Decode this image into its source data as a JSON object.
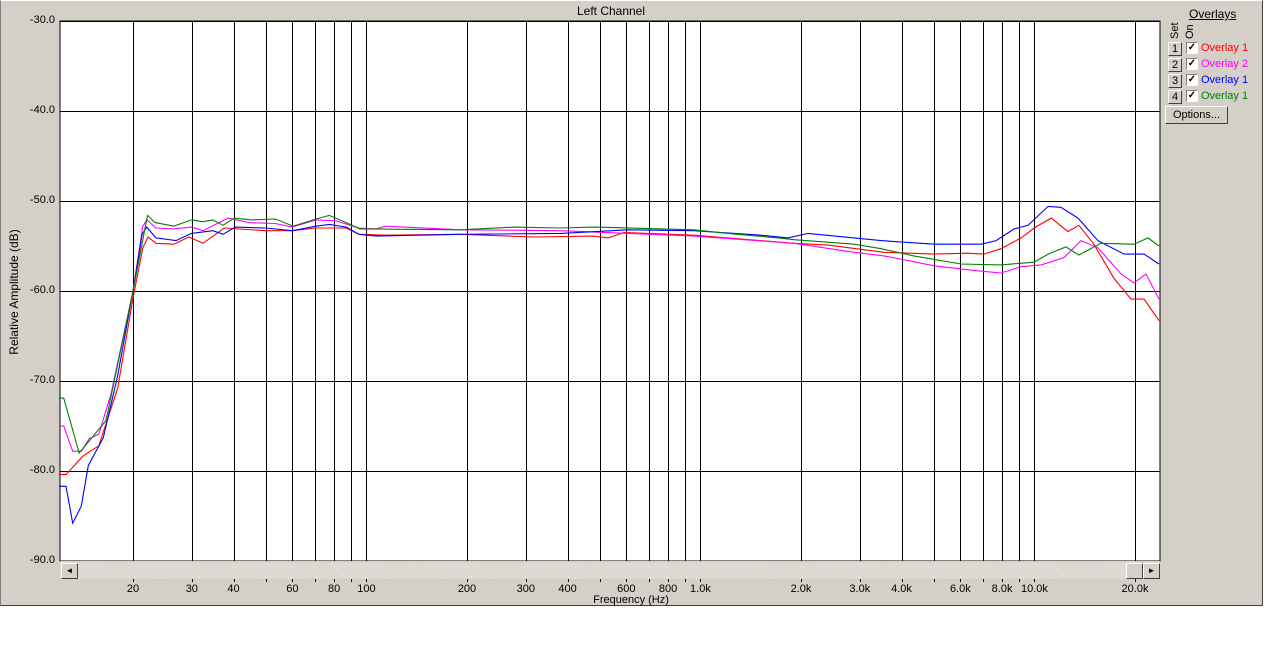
{
  "window": {
    "title": "Left Channel"
  },
  "overlays": {
    "title": "Overlays",
    "col_set": "Set",
    "col_on": "On",
    "items": [
      {
        "set": "1",
        "on": true,
        "label": "Overlay 1",
        "color": "#ff0000"
      },
      {
        "set": "2",
        "on": true,
        "label": "Overlay 2",
        "color": "#ff00ff"
      },
      {
        "set": "3",
        "on": true,
        "label": "Overlay 1",
        "color": "#0000ff"
      },
      {
        "set": "4",
        "on": true,
        "label": "Overlay 1",
        "color": "#008000"
      }
    ],
    "options_label": "Options..."
  },
  "scrollbar": {
    "left_arrow": "◄",
    "right_arrow": "►"
  },
  "chart_data": {
    "type": "line",
    "title": "Left Channel",
    "xlabel": "Frequency (Hz)",
    "ylabel": "Relative Amplitude (dB)",
    "xscale": "log",
    "xlim": [
      12,
      23600
    ],
    "ylim": [
      -90,
      -30
    ],
    "grid": true,
    "y_ticks": [
      -30,
      -40,
      -50,
      -60,
      -70,
      -80,
      -90
    ],
    "y_tick_labels": [
      "-30.0",
      "-40.0",
      "-50.0",
      "-60.0",
      "-70.0",
      "-80.0",
      "-90.0"
    ],
    "x_gridlines": [
      20,
      30,
      40,
      50,
      60,
      70,
      80,
      90,
      100,
      200,
      300,
      400,
      500,
      600,
      700,
      800,
      900,
      1000,
      2000,
      3000,
      4000,
      5000,
      6000,
      7000,
      8000,
      9000,
      10000,
      20000
    ],
    "x_ticks": [
      20,
      30,
      40,
      60,
      80,
      100,
      200,
      300,
      400,
      600,
      800,
      1000,
      2000,
      3000,
      4000,
      6000,
      8000,
      10000,
      20000
    ],
    "x_tick_labels": [
      "20",
      "30",
      "40",
      "60",
      "80",
      "100",
      "200",
      "300",
      "400",
      "600",
      "800",
      "1.0k",
      "2.0k",
      "3.0k",
      "4.0k",
      "6.0k",
      "8.0k",
      "10.0k",
      "20.0k"
    ],
    "series": [
      {
        "name": "Overlay 1 (set 1)",
        "color": "#ff0000",
        "points": [
          [
            12.0,
            -80.4
          ],
          [
            12.6,
            -80.4
          ],
          [
            14.2,
            -78.3
          ],
          [
            15.8,
            -77.2
          ],
          [
            18.0,
            -70.8
          ],
          [
            20,
            -60.8
          ],
          [
            21.4,
            -55.2
          ],
          [
            22.2,
            -54.0
          ],
          [
            23.4,
            -54.7
          ],
          [
            26.5,
            -54.8
          ],
          [
            29.4,
            -54.0
          ],
          [
            32.4,
            -54.7
          ],
          [
            37.5,
            -53.0
          ],
          [
            50,
            -53.3
          ],
          [
            60,
            -53.3
          ],
          [
            70.6,
            -53.0
          ],
          [
            87,
            -53.0
          ],
          [
            95,
            -53.7
          ],
          [
            114,
            -53.8
          ],
          [
            192,
            -53.7
          ],
          [
            317,
            -54.0
          ],
          [
            480,
            -53.9
          ],
          [
            529,
            -54.1
          ],
          [
            590,
            -53.5
          ],
          [
            956,
            -53.8
          ],
          [
            1906,
            -54.7
          ],
          [
            2410,
            -54.9
          ],
          [
            3546,
            -55.7
          ],
          [
            5002,
            -55.9
          ],
          [
            6325,
            -55.8
          ],
          [
            7067,
            -55.9
          ],
          [
            7942,
            -55.3
          ],
          [
            9120,
            -54.1
          ],
          [
            9978,
            -53.0
          ],
          [
            11220,
            -51.9
          ],
          [
            12600,
            -53.4
          ],
          [
            13580,
            -52.7
          ],
          [
            15070,
            -54.8
          ],
          [
            17300,
            -58.6
          ],
          [
            19450,
            -60.9
          ],
          [
            21280,
            -60.9
          ],
          [
            23600,
            -63.3
          ]
        ]
      },
      {
        "name": "Overlay 2 (set 2)",
        "color": "#ff00ff",
        "points": [
          [
            12.0,
            -75.0
          ],
          [
            12.4,
            -75.0
          ],
          [
            13.2,
            -77.8
          ],
          [
            14.0,
            -77.8
          ],
          [
            14.8,
            -76.4
          ],
          [
            15.8,
            -75.9
          ],
          [
            17.2,
            -71.4
          ],
          [
            20,
            -60.0
          ],
          [
            21.4,
            -52.8
          ],
          [
            22.0,
            -52.1
          ],
          [
            23.4,
            -53.0
          ],
          [
            26.5,
            -53.1
          ],
          [
            29.9,
            -52.9
          ],
          [
            32.4,
            -53.3
          ],
          [
            38.5,
            -51.9
          ],
          [
            44.5,
            -52.4
          ],
          [
            53.4,
            -52.5
          ],
          [
            60,
            -52.9
          ],
          [
            70.6,
            -52.1
          ],
          [
            81,
            -52.2
          ],
          [
            95,
            -53.0
          ],
          [
            107,
            -53.1
          ],
          [
            114,
            -52.8
          ],
          [
            192,
            -53.2
          ],
          [
            382,
            -53.3
          ],
          [
            607,
            -53.6
          ],
          [
            956,
            -53.9
          ],
          [
            1906,
            -54.7
          ],
          [
            2884,
            -55.7
          ],
          [
            3546,
            -56.1
          ],
          [
            5002,
            -57.2
          ],
          [
            6920,
            -57.8
          ],
          [
            7942,
            -58.0
          ],
          [
            9120,
            -57.3
          ],
          [
            10470,
            -57.1
          ],
          [
            12250,
            -56.3
          ],
          [
            13780,
            -54.4
          ],
          [
            15490,
            -55.2
          ],
          [
            18160,
            -58.1
          ],
          [
            19860,
            -59.1
          ],
          [
            21580,
            -58.1
          ],
          [
            23600,
            -60.9
          ]
        ]
      },
      {
        "name": "Overlay 1 (set 3)",
        "color": "#0000ff",
        "points": [
          [
            12.0,
            -81.7
          ],
          [
            12.6,
            -81.7
          ],
          [
            13.2,
            -85.8
          ],
          [
            14.0,
            -83.9
          ],
          [
            14.7,
            -79.4
          ],
          [
            16.3,
            -76.3
          ],
          [
            18.0,
            -69.4
          ],
          [
            20,
            -60.0
          ],
          [
            21.3,
            -53.7
          ],
          [
            22.0,
            -52.9
          ],
          [
            23.4,
            -54.1
          ],
          [
            26.9,
            -54.4
          ],
          [
            29.9,
            -53.6
          ],
          [
            34.7,
            -53.3
          ],
          [
            37.2,
            -53.7
          ],
          [
            40.5,
            -52.9
          ],
          [
            50,
            -53.0
          ],
          [
            60,
            -53.3
          ],
          [
            70.6,
            -52.8
          ],
          [
            77.4,
            -52.6
          ],
          [
            87,
            -52.9
          ],
          [
            95,
            -53.7
          ],
          [
            107,
            -53.9
          ],
          [
            192,
            -53.7
          ],
          [
            382,
            -53.6
          ],
          [
            607,
            -53.2
          ],
          [
            956,
            -53.3
          ],
          [
            1518,
            -53.8
          ],
          [
            1828,
            -54.1
          ],
          [
            2099,
            -53.6
          ],
          [
            2884,
            -54.1
          ],
          [
            3473,
            -54.4
          ],
          [
            5002,
            -54.8
          ],
          [
            6920,
            -54.8
          ],
          [
            7675,
            -54.4
          ],
          [
            8690,
            -53.1
          ],
          [
            9572,
            -52.7
          ],
          [
            10990,
            -50.6
          ],
          [
            12000,
            -50.7
          ],
          [
            13500,
            -51.9
          ],
          [
            15490,
            -54.4
          ],
          [
            18540,
            -55.9
          ],
          [
            21280,
            -55.9
          ],
          [
            23600,
            -57.0
          ]
        ]
      },
      {
        "name": "Overlay 1 (set 4)",
        "color": "#008000",
        "points": [
          [
            12.0,
            -71.9
          ],
          [
            12.4,
            -71.9
          ],
          [
            13.8,
            -78.0
          ],
          [
            16.6,
            -74.4
          ],
          [
            20,
            -60.0
          ],
          [
            22.1,
            -51.6
          ],
          [
            23.3,
            -52.4
          ],
          [
            26.5,
            -52.8
          ],
          [
            29.9,
            -52.1
          ],
          [
            32.4,
            -52.3
          ],
          [
            34.7,
            -52.1
          ],
          [
            37.2,
            -52.7
          ],
          [
            40.2,
            -51.9
          ],
          [
            45.3,
            -52.1
          ],
          [
            53.4,
            -52.0
          ],
          [
            60.4,
            -52.8
          ],
          [
            70.6,
            -52.0
          ],
          [
            77.4,
            -51.6
          ],
          [
            87,
            -52.4
          ],
          [
            95.5,
            -53.1
          ],
          [
            96,
            -53.1
          ],
          [
            192,
            -53.2
          ],
          [
            276,
            -52.9
          ],
          [
            382,
            -53.0
          ],
          [
            480,
            -52.9
          ],
          [
            956,
            -53.2
          ],
          [
            1208,
            -53.6
          ],
          [
            1706,
            -54.1
          ],
          [
            1906,
            -54.3
          ],
          [
            2884,
            -54.8
          ],
          [
            3473,
            -55.3
          ],
          [
            4355,
            -56.1
          ],
          [
            6026,
            -57.0
          ],
          [
            7942,
            -57.1
          ],
          [
            9978,
            -56.8
          ],
          [
            10990,
            -55.9
          ],
          [
            12420,
            -55.1
          ],
          [
            13580,
            -56.0
          ],
          [
            15820,
            -54.7
          ],
          [
            19860,
            -54.8
          ],
          [
            21880,
            -54.1
          ],
          [
            23600,
            -55.0
          ]
        ]
      }
    ]
  }
}
